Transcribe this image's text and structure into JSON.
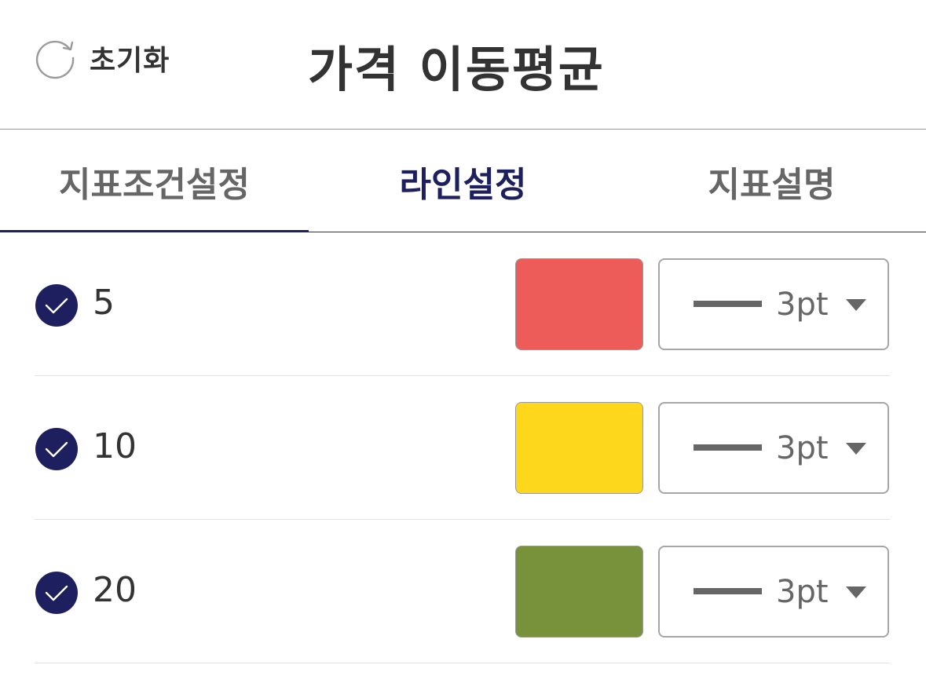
{
  "header": {
    "reset_label": "초기화",
    "reset_icon": "refresh-icon",
    "title": "가격 이동평균"
  },
  "tabs": [
    {
      "label": "지표조건설정",
      "active": false
    },
    {
      "label": "라인설정",
      "active": true
    },
    {
      "label": "지표설명",
      "active": false
    }
  ],
  "colors": {
    "accent": "#1e1f5e",
    "text": "#333333",
    "muted": "#666666"
  },
  "lines": [
    {
      "period": "5",
      "checked": true,
      "color": "#ee5c5a",
      "width_label": "3pt"
    },
    {
      "period": "10",
      "checked": true,
      "color": "#fdd71b",
      "width_label": "3pt"
    },
    {
      "period": "20",
      "checked": true,
      "color": "#77923a",
      "width_label": "3pt"
    }
  ]
}
